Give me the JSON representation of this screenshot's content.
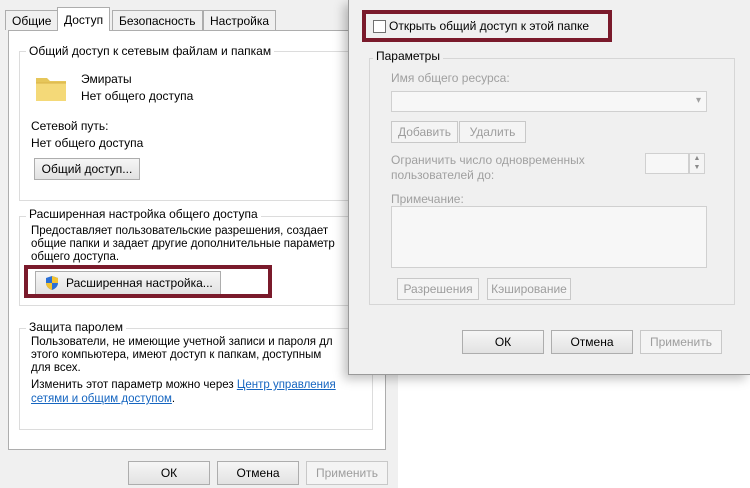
{
  "props": {
    "tabs": [
      "Общие",
      "Доступ",
      "Безопасность",
      "Настройка"
    ],
    "share_group_title": "Общий доступ к сетевым файлам и папкам",
    "folder_name": "Эмираты",
    "folder_status": "Нет общего доступа",
    "network_path_label": "Сетевой путь:",
    "network_path_value": "Нет общего доступа",
    "share_button": "Общий доступ...",
    "advanced_group_title": "Расширенная настройка общего доступа",
    "advanced_desc": [
      "Предоставляет пользовательские разрешения, создает",
      "общие папки и задает другие дополнительные параметр",
      "общего доступа."
    ],
    "advanced_button": "Расширенная настройка...",
    "password_group_title": "Защита паролем",
    "password_desc": [
      "Пользователи, не имеющие учетной записи и пароля дл",
      "этого компьютера, имеют доступ к папкам, доступным",
      "для всех."
    ],
    "change_text": "Изменить этот параметр можно через",
    "link_line1": "Центр управления",
    "link_line2": "сетями и общим доступом",
    "link_suffix": ".",
    "ok": "ОК",
    "cancel": "Отмена",
    "apply": "Применить"
  },
  "adv": {
    "share_checkbox_label": "Открыть общий доступ к этой папке",
    "share_checked": false,
    "params_title": "Параметры",
    "share_name_label": "Имя общего ресурса:",
    "add": "Добавить",
    "remove": "Удалить",
    "limit_label_1": "Ограничить число одновременных",
    "limit_label_2": "пользователей до:",
    "note_label": "Примечание:",
    "permissions": "Разрешения",
    "caching": "Кэширование",
    "ok": "ОК",
    "cancel": "Отмена",
    "apply": "Применить"
  },
  "colors": {
    "highlight": "#7a1a2b",
    "link": "#1565c0"
  },
  "icons": {
    "folder": "folder-icon",
    "shield": "uac-shield-icon",
    "dropdown": "chevron-down-icon",
    "spinner": "spinner-arrows-icon"
  }
}
